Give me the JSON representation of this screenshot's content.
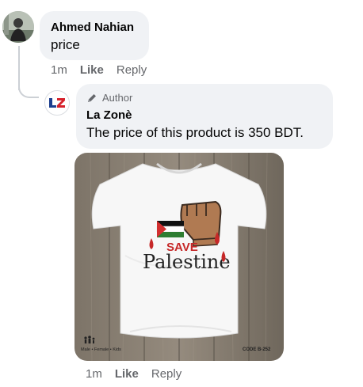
{
  "comment1": {
    "author": "Ahmed Nahian",
    "text": "price",
    "time": "1m",
    "like": "Like",
    "reply": "Reply"
  },
  "comment2": {
    "badge_label": "Author",
    "author": "La Zonè",
    "text": "The price of this product is 350 BDT.",
    "time": "1m",
    "like": "Like",
    "reply": "Reply",
    "attachment": {
      "save_word": "SAVE",
      "palestine_word": "Palestine",
      "tag_left": "Male • Female • Kids",
      "tag_right": "CODE  B-252"
    }
  },
  "colors": {
    "bubble": "#f0f2f5",
    "meta": "#65676b",
    "text": "#050505",
    "flag_red": "#d32f2f",
    "flag_green": "#2e7d32"
  }
}
